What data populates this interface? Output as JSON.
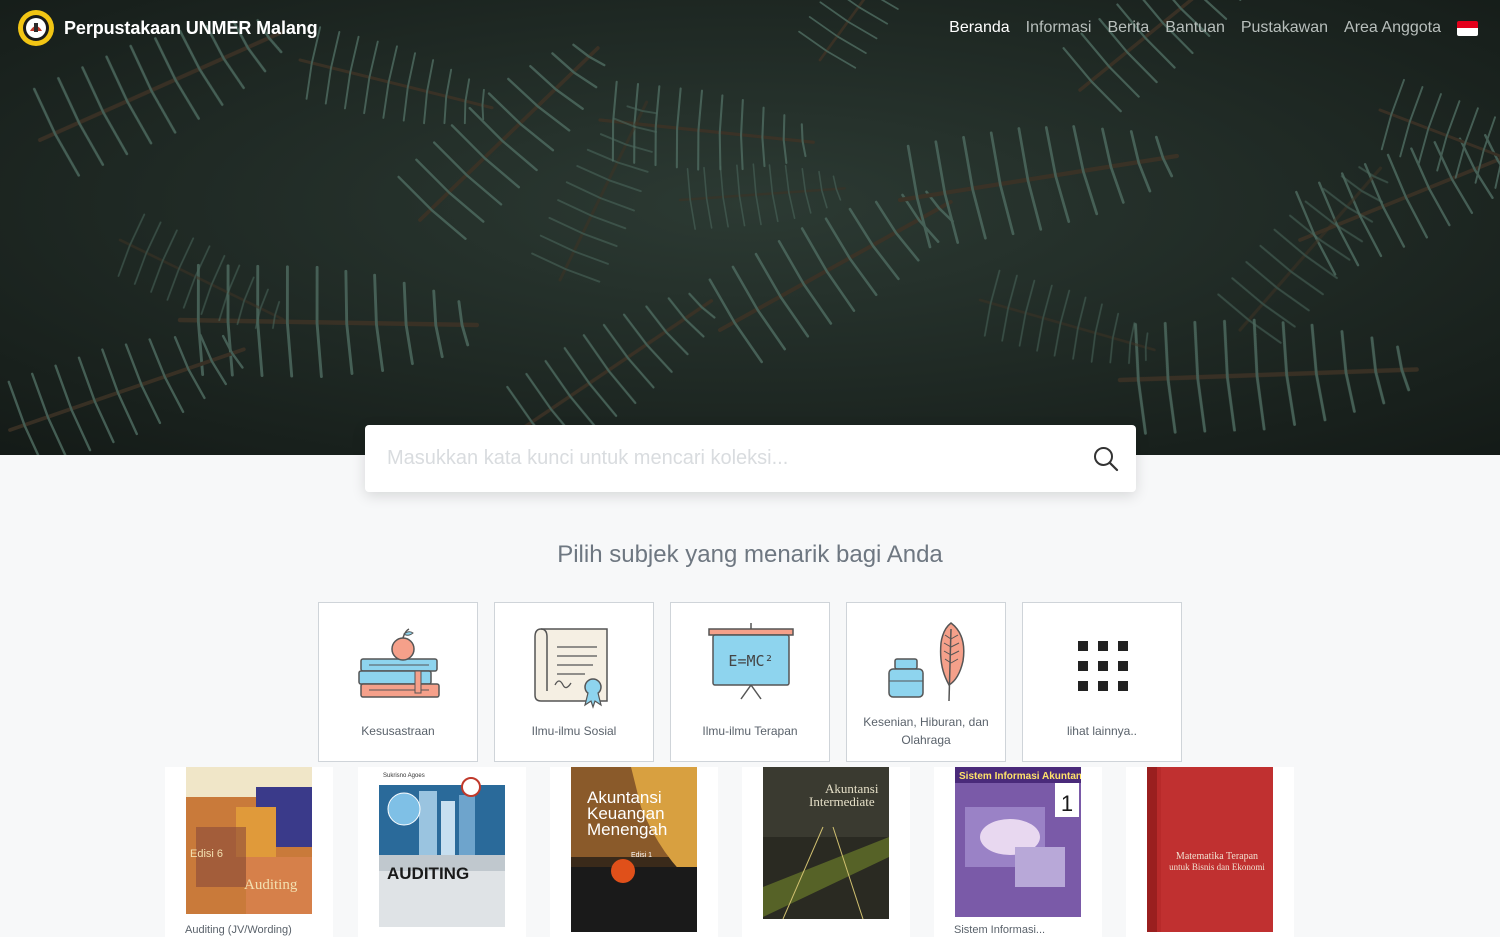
{
  "header": {
    "brand_title": "Perpustakaan UNMER Malang",
    "nav": [
      {
        "label": "Beranda",
        "active": true
      },
      {
        "label": "Informasi"
      },
      {
        "label": "Berita"
      },
      {
        "label": "Bantuan"
      },
      {
        "label": "Pustakawan"
      },
      {
        "label": "Area Anggota"
      }
    ],
    "language_flag": "indonesia-flag-icon"
  },
  "search": {
    "placeholder": "Masukkan kata kunci untuk mencari koleksi...",
    "value": "",
    "icon": "search-icon"
  },
  "subjects": {
    "heading": "Pilih subjek yang menarik bagi Anda",
    "items": [
      {
        "label": "Kesusastraan",
        "icon": "books-apple-icon"
      },
      {
        "label": "Ilmu-ilmu Sosial",
        "icon": "certificate-scroll-icon"
      },
      {
        "label": "Ilmu-ilmu Terapan",
        "icon": "whiteboard-formula-icon"
      },
      {
        "label": "Kesenian, Hiburan, dan Olahraga",
        "icon": "inkwell-feather-icon"
      },
      {
        "label": "lihat lainnya..",
        "icon": "grid-icon"
      }
    ],
    "formula_text": "E=MC²"
  },
  "books": [
    {
      "caption": "Auditing (JV/Wording)",
      "cover_title": "Auditing",
      "cover_sub": "Edisi 6"
    },
    {
      "caption": "",
      "cover_title": "AUDITING",
      "cover_sub": "Sukrisno Agoes"
    },
    {
      "caption": "",
      "cover_title": "Akuntansi Keuangan Menengah",
      "cover_sub": "Edisi 1"
    },
    {
      "caption": "",
      "cover_title": "Akuntansi Intermediate",
      "cover_sub": ""
    },
    {
      "caption": "Sistem Informasi...",
      "cover_title": "Sistem Informasi Akuntansi",
      "cover_sub": "1"
    },
    {
      "caption": "",
      "cover_title": "Matematika Terapan untuk Bisnis dan Ekonomi",
      "cover_sub": ""
    }
  ],
  "colors": {
    "hero_dark": "#1c2420",
    "page_bg": "#f7f8f9",
    "card_border": "#cfd4d9",
    "icon_blue": "#8ed4ee",
    "icon_salmon": "#f5a08a",
    "nav_active": "#ffffff",
    "nav_inactive": "#b8bfbc"
  }
}
